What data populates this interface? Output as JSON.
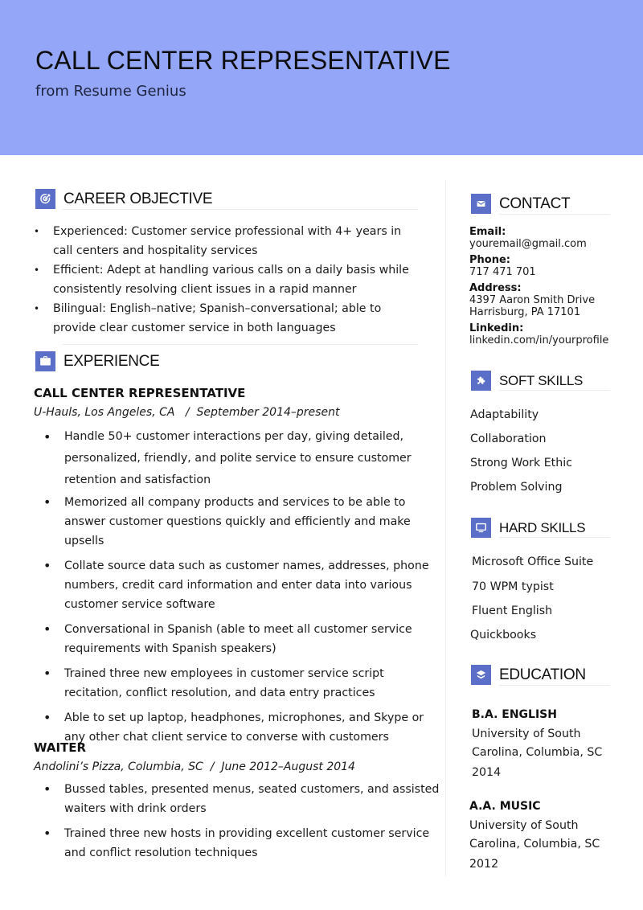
{
  "header": {
    "title": "CALL CENTER REPRESENTATIVE",
    "subtitle": "from Resume Genius",
    "background_color": "#94a6f7"
  },
  "accent_color": "#5b6fc9",
  "sections": {
    "career_objective": {
      "title": "CAREER OBJECTIVE",
      "icon": "target-icon",
      "items": [
        "Experienced: Customer service professional with 4+ years in call centers and hospitality services",
        "Efficient: Adept at handling various calls on a daily basis while consistently resolving client issues in a rapid manner",
        "Bilingual: English–native; Spanish–conversational; able to provide clear customer service in both languages"
      ]
    },
    "experience": {
      "title": "EXPERIENCE",
      "icon": "briefcase-icon",
      "jobs": [
        {
          "title": "CALL CENTER REPRESENTATIVE",
          "meta": "U-Hauls, Los Angeles, CA   /  September 2014–present",
          "bullets": [
            "Handle 50+ customer interactions per day, giving detailed, personalized, friendly, and polite service to ensure customer retention and satisfaction",
            "Memorized all company products and services to be able to answer customer questions quickly and efficiently and make upsells",
            "Collate source data such as customer names, addresses, phone numbers, credit card information and enter data into various customer service software",
            "Conversational in Spanish (able to meet all customer service requirements with Spanish speakers)",
            "Trained three new employees in customer service script recitation, conflict resolution, and data entry practices",
            "Able to set up laptop, headphones, microphones, and Skype or any other chat client service to converse with customers"
          ]
        },
        {
          "title": "WAITER",
          "meta": "Andolini’s Pizza, Columbia, SC  /  June 2012–August 2014",
          "bullets": [
            "Bussed tables, presented menus, seated customers, and assisted waiters with drink orders",
            "Trained three new hosts in providing excellent customer service and conflict resolution techniques"
          ]
        }
      ]
    },
    "contact": {
      "title": "CONTACT",
      "icon": "envelope-icon",
      "items": [
        {
          "label": "Email:",
          "lines": [
            "youremail@gmail.com"
          ]
        },
        {
          "label": "Phone:",
          "lines": [
            "717 471 701"
          ]
        },
        {
          "label": "Address:",
          "lines": [
            "4397 Aaron Smith Drive",
            "Harrisburg, PA 17101"
          ]
        },
        {
          "label": "Linkedin:",
          "lines": [
            "linkedin.com/in/yourprofile"
          ]
        }
      ]
    },
    "soft_skills": {
      "title": "SOFT SKILLS",
      "icon": "puzzle-icon",
      "items": [
        "Adaptability",
        "Collaboration",
        "Strong Work Ethic",
        "Problem Solving"
      ]
    },
    "hard_skills": {
      "title": "HARD SKILLS",
      "icon": "monitor-icon",
      "items": [
        "Microsoft Office Suite",
        "70 WPM typist",
        "Fluent English",
        "Quickbooks"
      ]
    },
    "education": {
      "title": "EDUCATION",
      "icon": "graduation-cap-icon",
      "items": [
        {
          "degree": "B.A. ENGLISH",
          "school": [
            "University of South",
            "Carolina, Columbia, SC"
          ],
          "year": "2014"
        },
        {
          "degree": "A.A. MUSIC",
          "school": [
            "University of South",
            "Carolina, Columbia, SC"
          ],
          "year": "2012"
        }
      ]
    }
  }
}
